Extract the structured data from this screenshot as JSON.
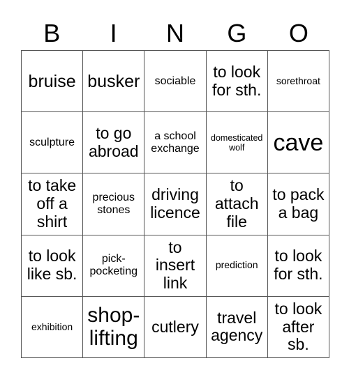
{
  "card": {
    "title": "BINGO",
    "header_letters": [
      "B",
      "I",
      "N",
      "G",
      "O"
    ],
    "grid_size": "5x5",
    "text_color": "#000000",
    "border_color": "#555555",
    "background_color": "#ffffff",
    "rows": [
      [
        {
          "text": "bruise",
          "size": "lg"
        },
        {
          "text": "busker",
          "size": "lg"
        },
        {
          "text": "sociable",
          "size": "sm"
        },
        {
          "text": "to look for sth.",
          "size": "md"
        },
        {
          "text": "sorethroat",
          "size": "xs"
        }
      ],
      [
        {
          "text": "sculpture",
          "size": "sm"
        },
        {
          "text": "to go abroad",
          "size": "md"
        },
        {
          "text": "a school exchange",
          "size": "sm"
        },
        {
          "text": "domesticated wolf",
          "size": "xxs"
        },
        {
          "text": "cave",
          "size": "xxl"
        }
      ],
      [
        {
          "text": "to take off a shirt",
          "size": "md"
        },
        {
          "text": "precious stones",
          "size": "sm"
        },
        {
          "text": "driving licence",
          "size": "md"
        },
        {
          "text": "to attach file",
          "size": "md"
        },
        {
          "text": "to pack a bag",
          "size": "md"
        }
      ],
      [
        {
          "text": "to look like sb.",
          "size": "md"
        },
        {
          "text": "pick-pocketing",
          "size": "sm"
        },
        {
          "text": "to insert link",
          "size": "md"
        },
        {
          "text": "prediction",
          "size": "xs"
        },
        {
          "text": "to look for sth.",
          "size": "md"
        }
      ],
      [
        {
          "text": "exhibition",
          "size": "xs"
        },
        {
          "text": "shop-lifting",
          "size": "xl"
        },
        {
          "text": "cutlery",
          "size": "md"
        },
        {
          "text": "travel agency",
          "size": "md"
        },
        {
          "text": "to look after sb.",
          "size": "md"
        }
      ]
    ]
  }
}
